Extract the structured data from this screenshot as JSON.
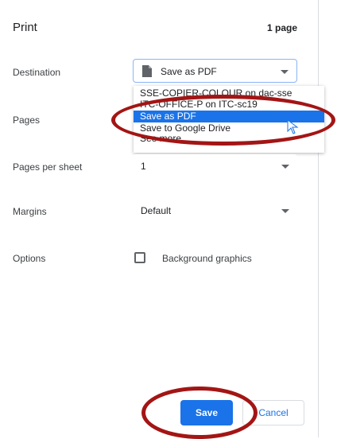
{
  "header": {
    "title": "Print",
    "page_count": "1 page"
  },
  "destination": {
    "label": "Destination",
    "selected": "Save as PDF",
    "icon": "document-icon",
    "options": [
      "SSE-COPIER-COLOUR on dac-sse",
      "ITC-OFFICE-P on ITC-sc19",
      "Save as PDF",
      "Save to Google Drive",
      "See more..."
    ],
    "highlighted_option": "Save as PDF"
  },
  "pages": {
    "label": "Pages"
  },
  "pages_per_sheet": {
    "label": "Pages per sheet",
    "value": "1"
  },
  "margins": {
    "label": "Margins",
    "value": "Default"
  },
  "options": {
    "label": "Options",
    "background_graphics_label": "Background graphics",
    "background_graphics_checked": false
  },
  "actions": {
    "save_label": "Save",
    "cancel_label": "Cancel"
  },
  "colors": {
    "accent": "#1a73e8",
    "annotation": "#a31515"
  }
}
